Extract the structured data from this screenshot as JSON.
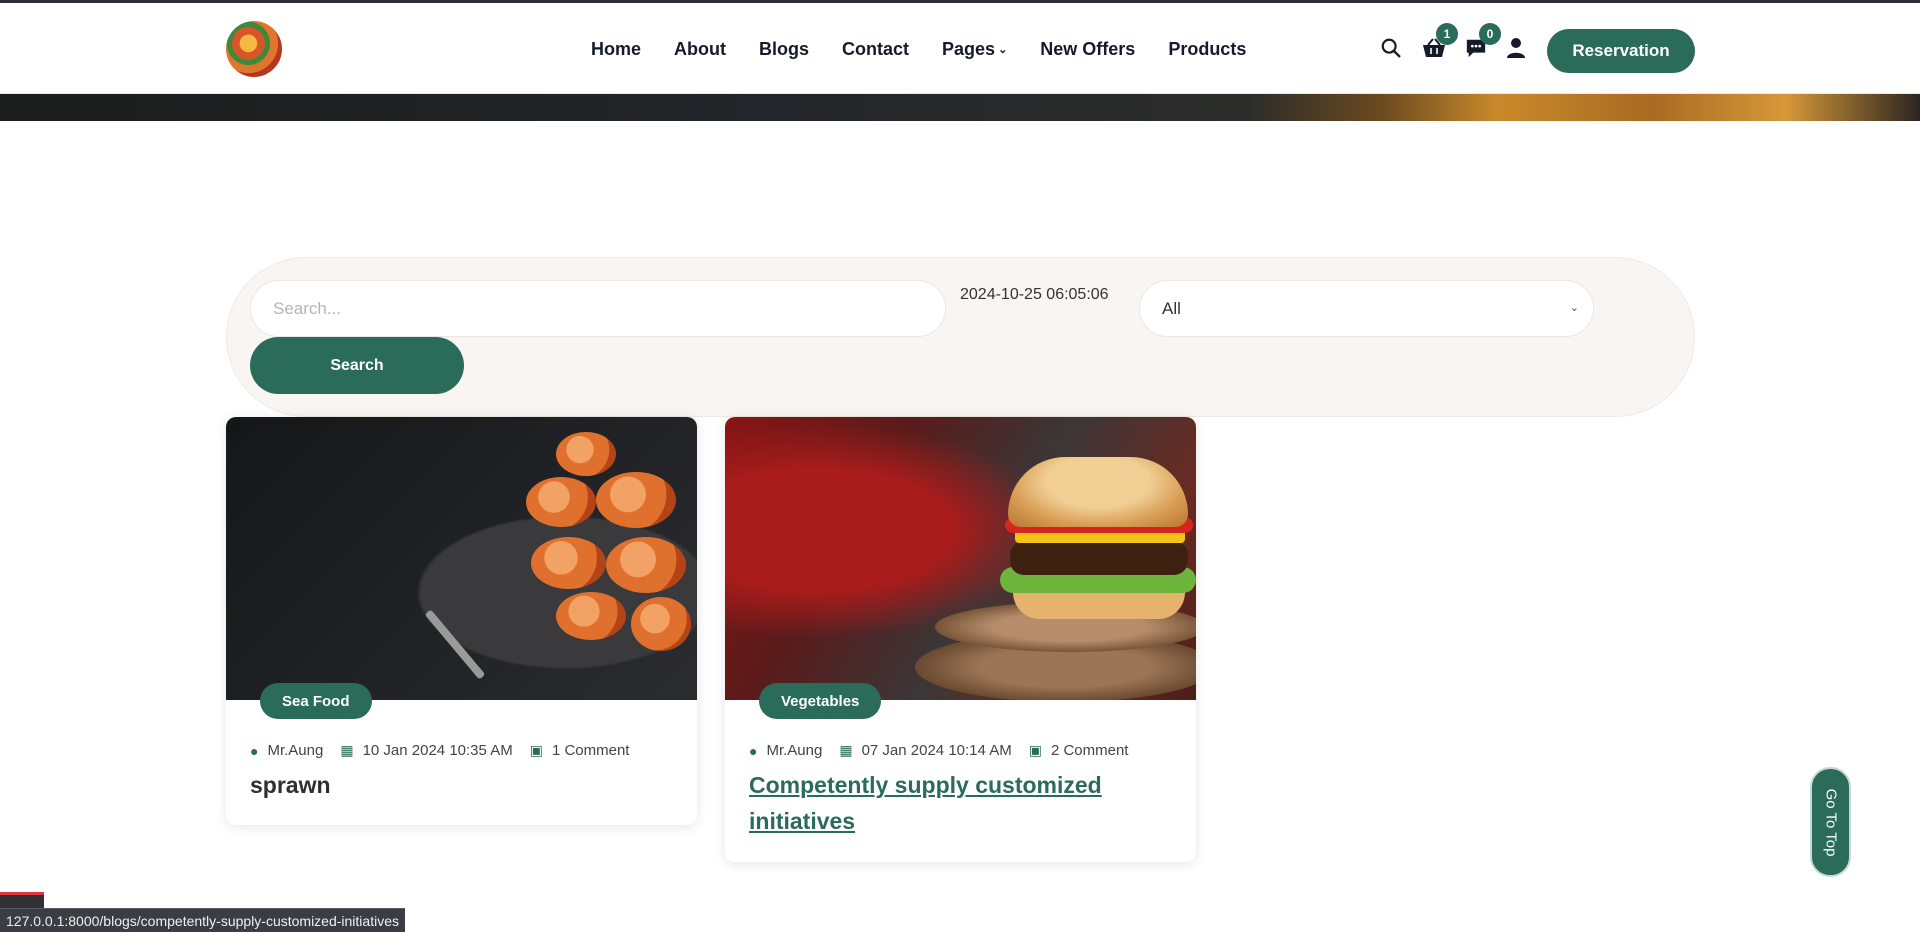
{
  "header": {
    "nav": [
      {
        "label": "Home"
      },
      {
        "label": "About"
      },
      {
        "label": "Blogs"
      },
      {
        "label": "Contact"
      },
      {
        "label": "Pages"
      },
      {
        "label": "New Offers"
      },
      {
        "label": "Products"
      }
    ],
    "cart_count": "1",
    "message_count": "0",
    "reservation_label": "Reservation",
    "icons": [
      "search-icon",
      "basket-icon",
      "chat-icon",
      "user-icon"
    ]
  },
  "search": {
    "placeholder": "Search...",
    "timestamp": "2024-10-25 06:05:06",
    "category_selected": "All",
    "button_label": "Search"
  },
  "posts": [
    {
      "category": "Sea Food",
      "author": "Mr.Aung",
      "date": "10 Jan 2024 10:35 AM",
      "comments": "1 Comment",
      "title": "sprawn"
    },
    {
      "category": "Vegetables",
      "author": "Mr.Aung",
      "date": "07 Jan 2024 10:14 AM",
      "comments": "2 Comment",
      "title": "Competently supply customized initiatives"
    }
  ],
  "go_top_label": "Go To Top",
  "status_url": "127.0.0.1:8000/blogs/competently-supply-customized-initiatives",
  "colors": {
    "accent": "#2a6b59",
    "panel": "#f8f5f2"
  }
}
